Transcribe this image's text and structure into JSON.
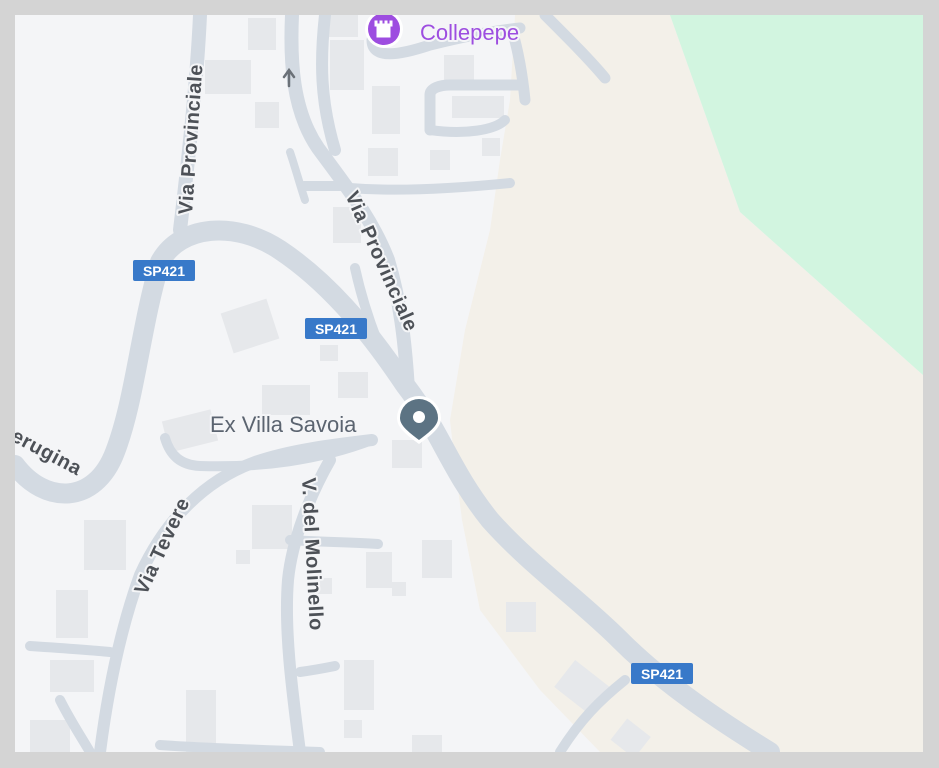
{
  "map": {
    "colors": {
      "frame": "#d4d4d4",
      "land": "#f4f5f7",
      "road": "#d3dae2",
      "building": "#e6e8eb",
      "field": "#f3f0e9",
      "park": "#d2f5e0",
      "shield": "#3879c9",
      "poi": "#9d4de0",
      "pin": "#5c7383"
    },
    "places": {
      "collepepe": {
        "name": "Collepepe",
        "icon": "castle-icon"
      },
      "villa": {
        "name": "Ex Villa Savoia",
        "icon": "location-pin-icon"
      }
    },
    "roads": {
      "via_provinciale_west": "Via Provinciale",
      "via_provinciale_center": "Via Provinciale",
      "via_tevere": "Via Tevere",
      "via_molinello": "V. del Molinello",
      "perugina_partial": "erugina"
    },
    "shields": [
      "SP421",
      "SP421",
      "SP421"
    ]
  }
}
